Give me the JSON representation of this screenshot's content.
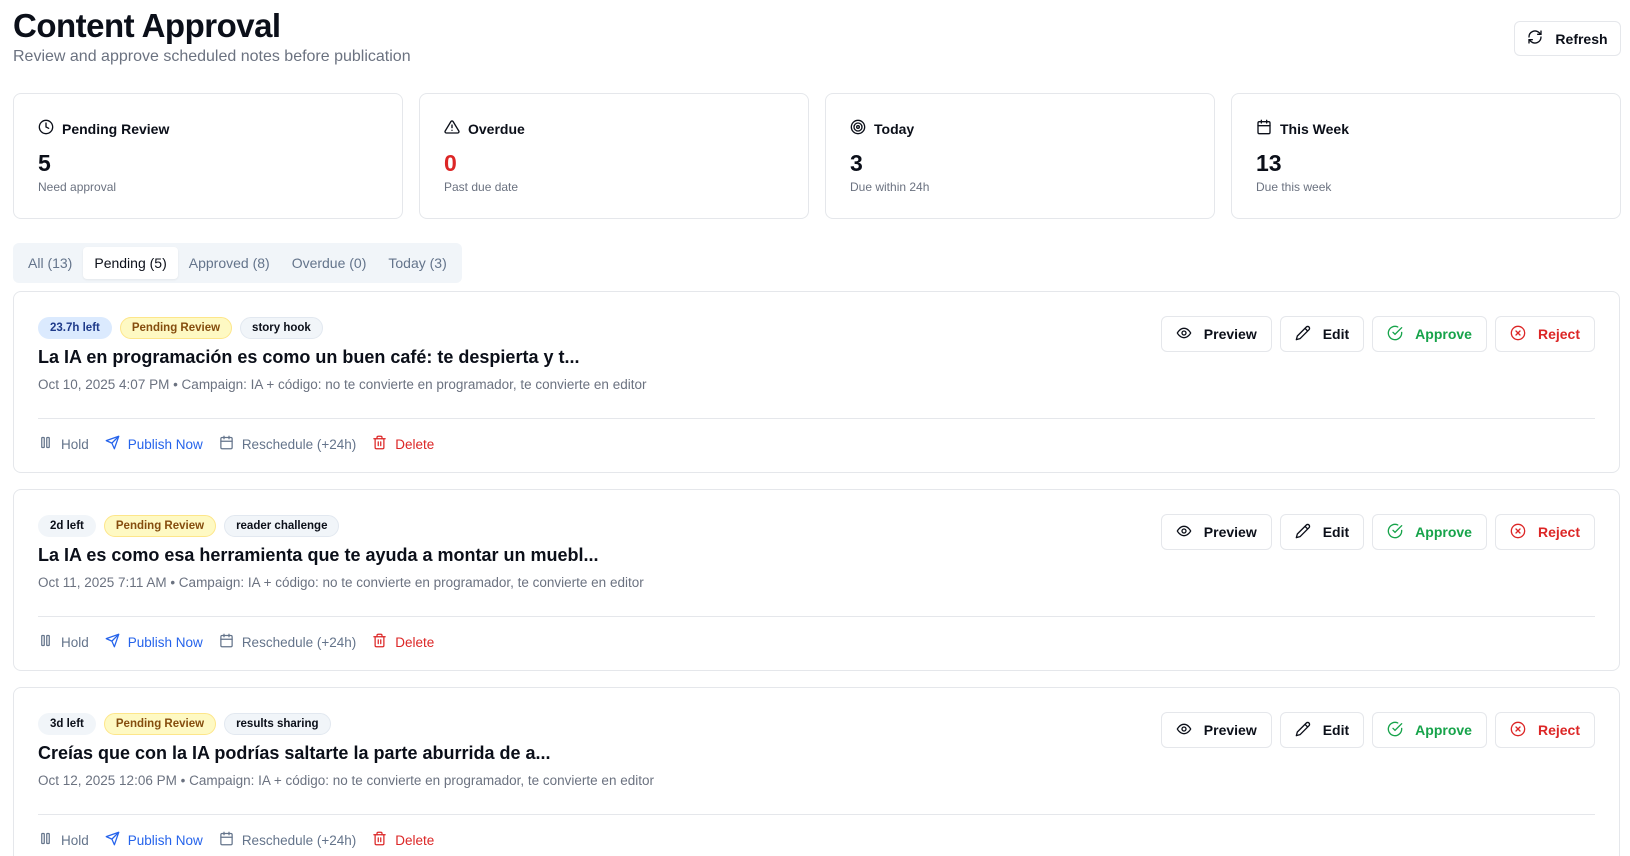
{
  "header": {
    "title": "Content Approval",
    "subtitle": "Review and approve scheduled notes before publication",
    "refresh_label": "Refresh"
  },
  "stats": [
    {
      "label": "Pending Review",
      "value": "5",
      "desc": "Need approval",
      "icon": "clock-icon"
    },
    {
      "label": "Overdue",
      "value": "0",
      "desc": "Past due date",
      "icon": "warning-icon",
      "value_color": "#dc2626"
    },
    {
      "label": "Today",
      "value": "3",
      "desc": "Due within 24h",
      "icon": "target-icon"
    },
    {
      "label": "This Week",
      "value": "13",
      "desc": "Due this week",
      "icon": "calendar-icon"
    }
  ],
  "tabs": [
    {
      "label": "All (13)",
      "active": false
    },
    {
      "label": "Pending (5)",
      "active": true
    },
    {
      "label": "Approved (8)",
      "active": false
    },
    {
      "label": "Overdue (0)",
      "active": false
    },
    {
      "label": "Today (3)",
      "active": false
    }
  ],
  "actions": {
    "preview": "Preview",
    "edit": "Edit",
    "approve": "Approve",
    "reject": "Reject",
    "hold": "Hold",
    "publish_now": "Publish Now",
    "reschedule": "Reschedule (+24h)",
    "delete": "Delete"
  },
  "colors": {
    "approve": "#16a34a",
    "reject": "#dc2626",
    "publish": "#2563eb",
    "pending_badge_bg": "#fef9c3",
    "time_badge_blue": "#dbeafe"
  },
  "items": [
    {
      "time_left": "23.7h left",
      "status": "Pending Review",
      "tag": "story hook",
      "title": "La IA en programación es como un buen café: te despierta y t...",
      "meta": "Oct 10, 2025 4:07 PM • Campaign: IA + código: no te convierte en programador, te convierte en editor"
    },
    {
      "time_left": "2d left",
      "status": "Pending Review",
      "tag": "reader challenge",
      "title": "La IA es como esa herramienta que te ayuda a montar un muebl...",
      "meta": "Oct 11, 2025 7:11 AM • Campaign: IA + código: no te convierte en programador, te convierte en editor"
    },
    {
      "time_left": "3d left",
      "status": "Pending Review",
      "tag": "results sharing",
      "title": "Creías que con la IA podrías saltarte la parte aburrida de a...",
      "meta": "Oct 12, 2025 12:06 PM • Campaign: IA + código: no te convierte en programador, te convierte en editor"
    }
  ]
}
